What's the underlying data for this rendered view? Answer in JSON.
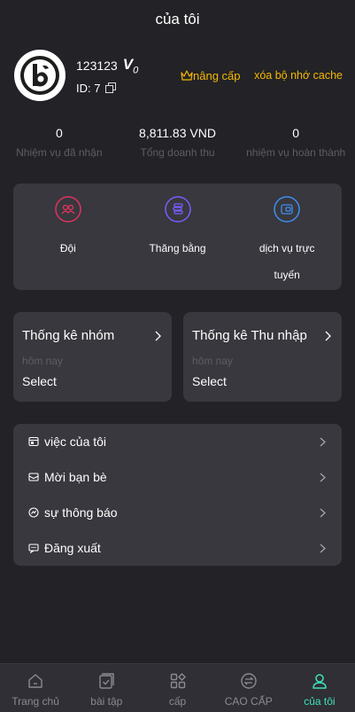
{
  "header": {
    "title": "của tôi"
  },
  "profile": {
    "username": "123123",
    "vip_level": "V",
    "vip_sub": "0",
    "id_label": "ID: 7",
    "upgrade_label": "nâng cấp",
    "clear_cache_label": "xóa bộ nhớ cache"
  },
  "stats": [
    {
      "value": "0",
      "label": "Nhiệm vụ đã nhận"
    },
    {
      "value": "8,811.83 VND",
      "label": "Tổng doanh thu"
    },
    {
      "value": "0",
      "label": "nhiệm vụ hoàn thành"
    }
  ],
  "quick_actions": [
    {
      "label": "Đội",
      "icon": "team-icon",
      "color": "#e2335f"
    },
    {
      "label": "Thăng bằng",
      "icon": "coins-icon",
      "color": "#7b5cff"
    },
    {
      "label": "dịch vụ trực tuyến",
      "icon": "wallet-icon",
      "color": "#3f8ff0"
    }
  ],
  "cards": [
    {
      "title": "Thống kê nhóm",
      "sub": "hôm nay",
      "value": "Select"
    },
    {
      "title": "Thống kê Thu nhập",
      "sub": "hôm nay",
      "value": "Select"
    }
  ],
  "menu": [
    {
      "label": "việc của tôi",
      "icon": "task-icon"
    },
    {
      "label": "Mời bạn bè",
      "icon": "invite-icon"
    },
    {
      "label": "sự thông báo",
      "icon": "notification-icon"
    },
    {
      "label": "Đăng xuất",
      "icon": "logout-icon"
    }
  ],
  "tabs": [
    {
      "label": "Trang chủ",
      "icon": "home-icon",
      "active": false
    },
    {
      "label": "bài tập",
      "icon": "exercise-icon",
      "active": false
    },
    {
      "label": "cấp",
      "icon": "grid-icon",
      "active": false
    },
    {
      "label": "CAO CẤP",
      "icon": "exchange-icon",
      "active": false
    },
    {
      "label": "của tôi",
      "icon": "user-icon",
      "active": true
    }
  ],
  "colors": {
    "accent": "#3fe0bb",
    "gold": "#f5b800",
    "background": "#222227",
    "card": "#38383e"
  }
}
